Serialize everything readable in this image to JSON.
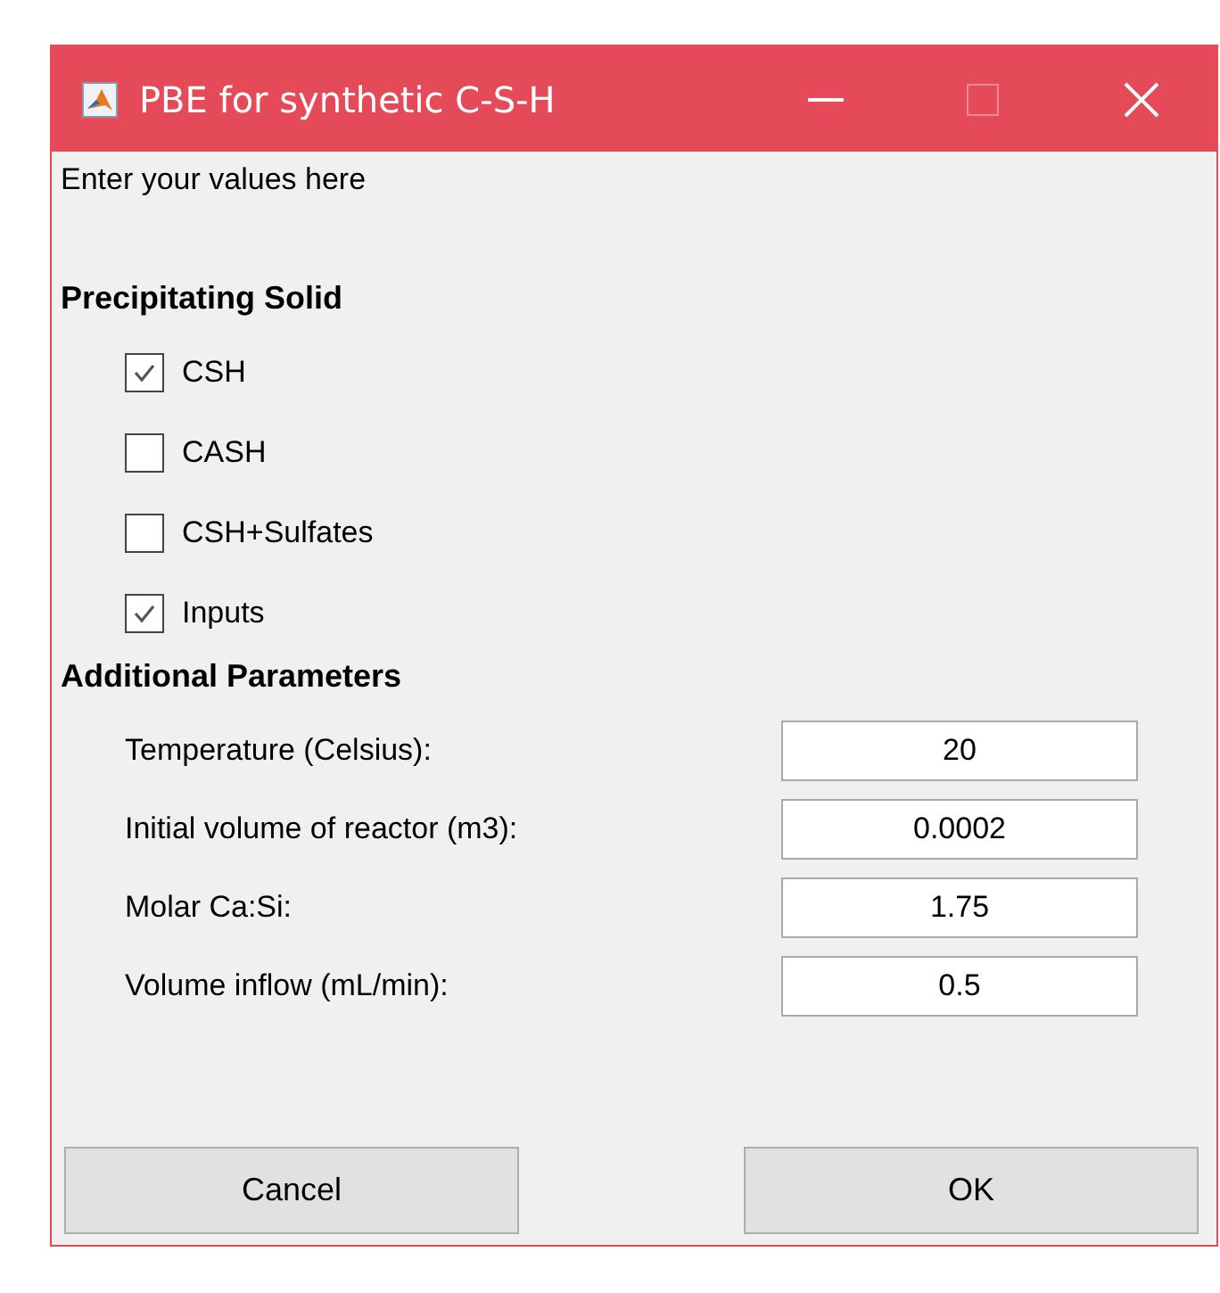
{
  "window": {
    "title": "PBE for synthetic C-S-H"
  },
  "intro": "Enter your values here",
  "solid": {
    "heading": "Precipitating Solid",
    "options": [
      {
        "label": "CSH",
        "checked": true
      },
      {
        "label": "CASH",
        "checked": false
      },
      {
        "label": "CSH+Sulfates",
        "checked": false
      },
      {
        "label": "Inputs",
        "checked": true
      }
    ]
  },
  "parameters": {
    "heading": "Additional Parameters",
    "fields": [
      {
        "label": "Temperature (Celsius):",
        "value": "20"
      },
      {
        "label": "Initial volume of reactor (m3):",
        "value": "0.0002"
      },
      {
        "label": "Molar Ca:Si:",
        "value": "1.75"
      },
      {
        "label": "Volume inflow (mL/min):",
        "value": "0.5"
      }
    ]
  },
  "buttons": [
    "Cancel",
    "OK"
  ]
}
